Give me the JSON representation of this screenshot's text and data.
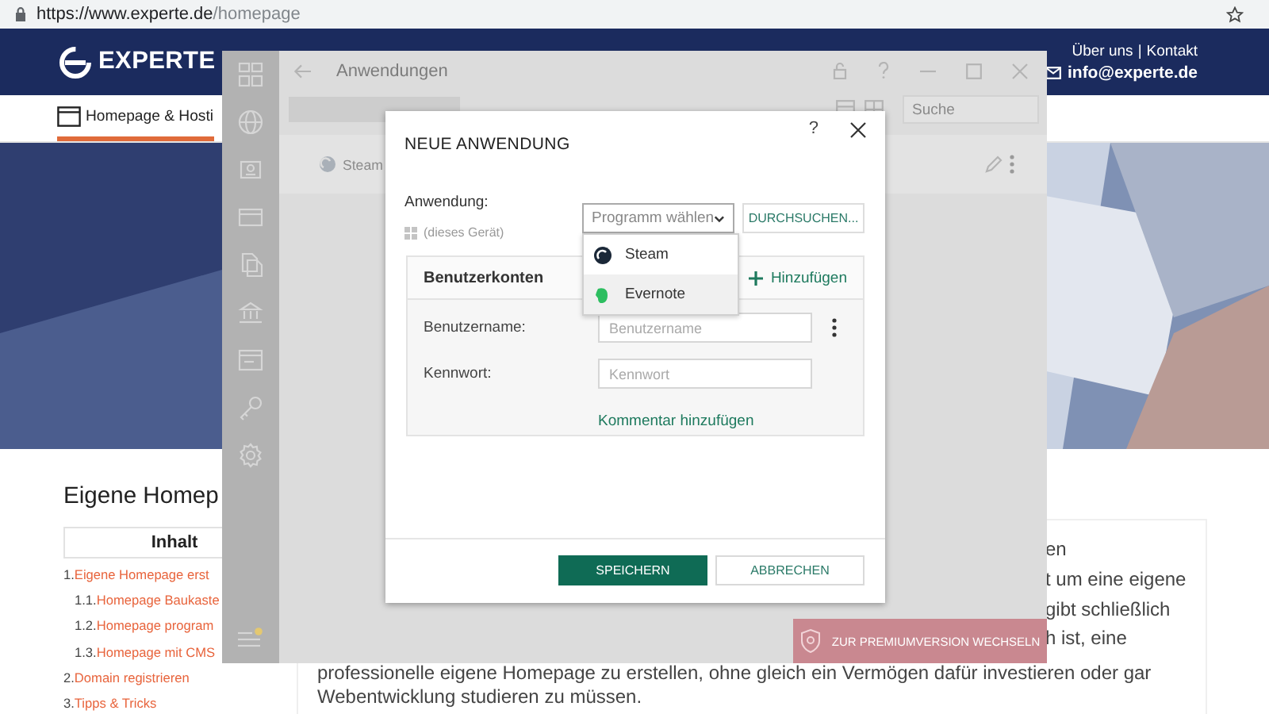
{
  "browser": {
    "url_host": "https://www.experte.de",
    "url_path": "/homepage"
  },
  "site": {
    "logo": "EXPERTE",
    "links": [
      "Über uns",
      "Kontakt"
    ],
    "separator": "|",
    "email": "info@experte.de",
    "nav": [
      {
        "label": "Homepage & Hosti",
        "selected": true
      }
    ]
  },
  "article": {
    "heading": "Eigene Homep",
    "toc": {
      "title": "Inhalt",
      "items": [
        {
          "number": "1.",
          "label": "Eigene Homepage erst",
          "children": [
            {
              "number": "1.1.",
              "label": "Homepage Baukaste"
            },
            {
              "number": "1.2.",
              "label": "Homepage program"
            },
            {
              "number": "1.3.",
              "label": "Homepage mit CMS"
            }
          ]
        },
        {
          "number": "2.",
          "label": "Domain registrieren"
        },
        {
          "number": "3.",
          "label": "Tipps & Tricks"
        }
      ]
    },
    "lines": [
      {
        "text": "en",
        "kind": "fragment"
      },
      {
        "text": "t um eine eigene",
        "kind": "fragment"
      },
      {
        "text": "gibt schließlich",
        "kind": "fragment"
      },
      {
        "text": "h ist, eine",
        "kind": "fragment"
      },
      {
        "text": "professionelle eigene Homepage zu erstellen, ohne gleich ein Vermögen dafür investieren oder gar",
        "kind": "full"
      },
      {
        "text": "Webentwicklung studieren zu müssen.",
        "kind": "full"
      }
    ]
  },
  "app": {
    "title": "Anwendungen",
    "search": {
      "placeholder": "Suche"
    },
    "entries": [
      {
        "name": "Steam"
      }
    ],
    "premium": "ZUR PREMIUMVERSION WECHSELN",
    "dialog": {
      "title": "NEUE ANWENDUNG",
      "help": "?",
      "application_label": "Anwendung:",
      "device": "(dieses Gerät)",
      "select": {
        "placeholder": "Programm wählen",
        "expanded": true,
        "options": [
          {
            "label": "Steam",
            "selected": false
          },
          {
            "label": "Evernote",
            "selected": true
          }
        ]
      },
      "browse": "DURCHSUCHEN...",
      "accounts": {
        "title": "Benutzerkonten",
        "add": "Hinzufügen",
        "fields": [
          {
            "label": "Benutzername:",
            "placeholder": "Benutzername"
          },
          {
            "label": "Kennwort:",
            "placeholder": "Kennwort"
          }
        ],
        "comment_link": "Kommentar hinzufügen"
      },
      "buttons": [
        {
          "label": "SPEICHERN",
          "kind": "primary"
        },
        {
          "label": "ABBRECHEN",
          "kind": "secondary"
        }
      ]
    }
  }
}
